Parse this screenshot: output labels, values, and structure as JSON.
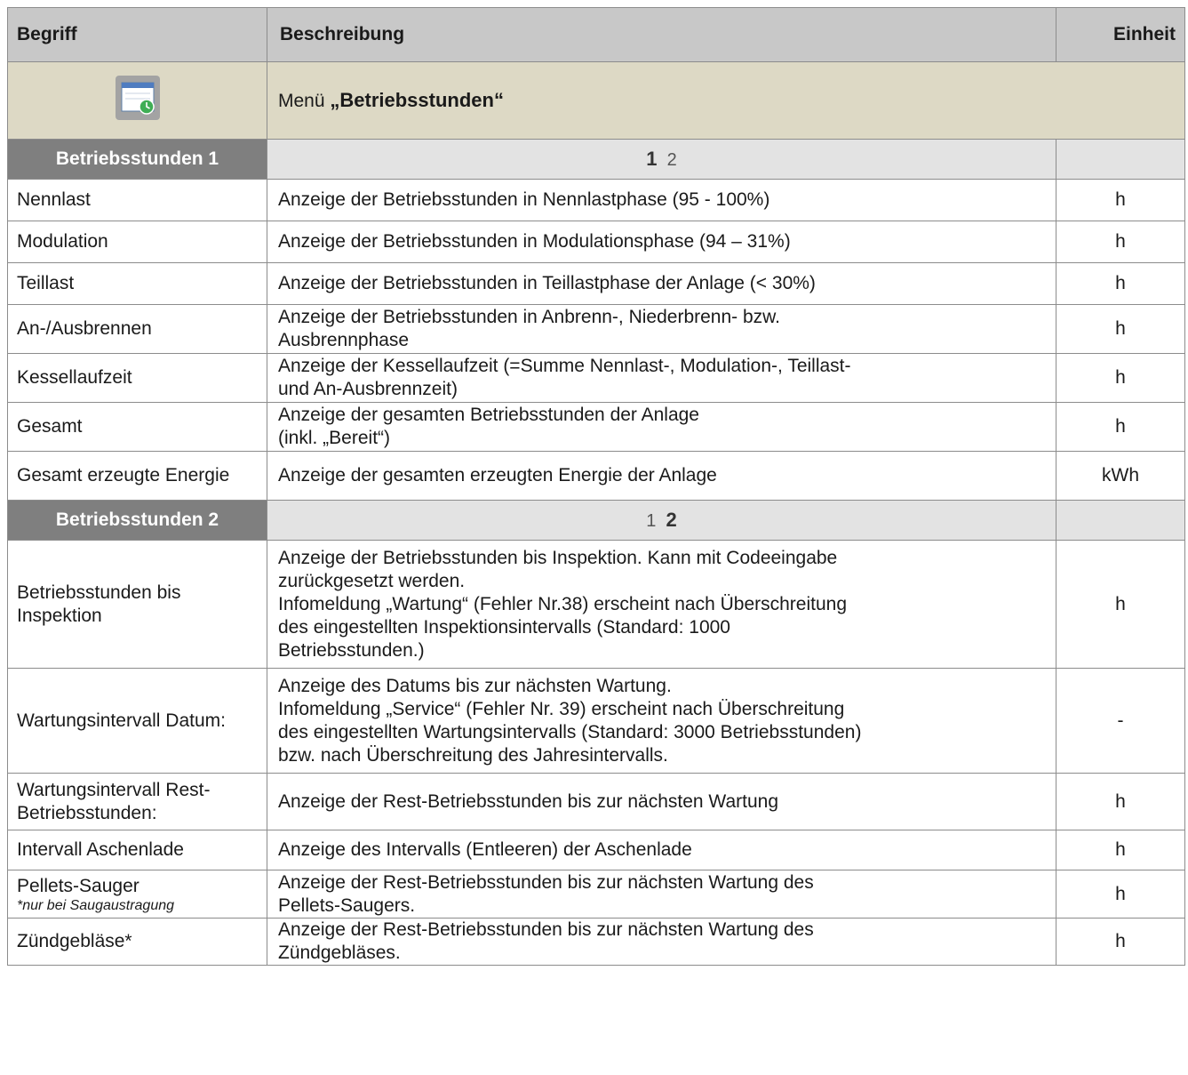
{
  "header": {
    "term": "Begriff",
    "description": "Beschreibung",
    "unit": "Einheit"
  },
  "menu": {
    "prefix": "Menü ",
    "name": "„Betriebsstunden“",
    "icon": "calendar-clock-icon"
  },
  "sections": [
    {
      "label": "Betriebsstunden 1",
      "pages": [
        "1",
        "2"
      ],
      "active_page": 0,
      "rows": [
        {
          "term": "Nennlast",
          "desc": [
            "Anzeige der Betriebsstunden in Nennlastphase (95 - 100%)"
          ],
          "unit": "h"
        },
        {
          "term": "Modulation",
          "desc": [
            "Anzeige der Betriebsstunden in Modulationsphase (94 – 31%)"
          ],
          "unit": "h"
        },
        {
          "term": "Teillast",
          "desc": [
            "Anzeige der Betriebsstunden in Teillastphase der Anlage (< 30%)"
          ],
          "unit": "h"
        },
        {
          "term": "An-/Ausbrennen",
          "desc": [
            "Anzeige der Betriebsstunden in Anbrenn-, Niederbrenn- bzw.",
            "Ausbrennphase"
          ],
          "unit": "h"
        },
        {
          "term": "Kessellaufzeit",
          "desc": [
            "Anzeige der Kessellaufzeit (=Summe Nennlast-, Modulation-, Teillast-",
            "und An-Ausbrennzeit)"
          ],
          "unit": "h"
        },
        {
          "term": "Gesamt",
          "desc": [
            "Anzeige der gesamten Betriebsstunden der Anlage",
            "(inkl. „Bereit“)"
          ],
          "unit": "h"
        },
        {
          "term": "Gesamt erzeugte Energie",
          "desc": [
            "Anzeige der gesamten erzeugten Energie der Anlage"
          ],
          "unit": "kWh"
        }
      ]
    },
    {
      "label": "Betriebsstunden 2",
      "pages": [
        "1",
        "2"
      ],
      "active_page": 1,
      "rows": [
        {
          "term": "Betriebsstunden bis Inspektion",
          "desc": [
            "Anzeige der Betriebsstunden bis Inspektion. Kann mit Codeeingabe",
            "zurückgesetzt werden.",
            "Infomeldung „Wartung“ (Fehler Nr.38) erscheint nach Überschreitung",
            "des eingestellten Inspektionsintervalls (Standard: 1000",
            "Betriebsstunden.)"
          ],
          "unit": "h"
        },
        {
          "term": "Wartungsintervall Datum:",
          "desc": [
            "Anzeige des Datums bis zur nächsten Wartung.",
            "Infomeldung „Service“ (Fehler Nr. 39) erscheint nach Überschreitung",
            "des eingestellten Wartungsintervalls (Standard: 3000 Betriebsstunden)",
            "bzw. nach Überschreitung des Jahresintervalls."
          ],
          "unit": "-"
        },
        {
          "term": "Wartungsintervall Rest-Betriebsstunden:",
          "desc": [
            "Anzeige der Rest-Betriebsstunden bis zur nächsten Wartung"
          ],
          "unit": "h"
        },
        {
          "term": "Intervall Aschenlade",
          "desc": [
            "Anzeige des Intervalls (Entleeren) der Aschenlade"
          ],
          "unit": "h"
        },
        {
          "term": "Pellets-Sauger",
          "note": "*nur bei Saugaustragung",
          "desc": [
            "Anzeige der Rest-Betriebsstunden bis zur nächsten Wartung des",
            "Pellets-Saugers."
          ],
          "unit": "h"
        },
        {
          "term": "Zündgebläse*",
          "desc": [
            "Anzeige der Rest-Betriebsstunden bis zur nächsten Wartung des",
            "Zündgebläses."
          ],
          "unit": "h"
        }
      ]
    }
  ]
}
